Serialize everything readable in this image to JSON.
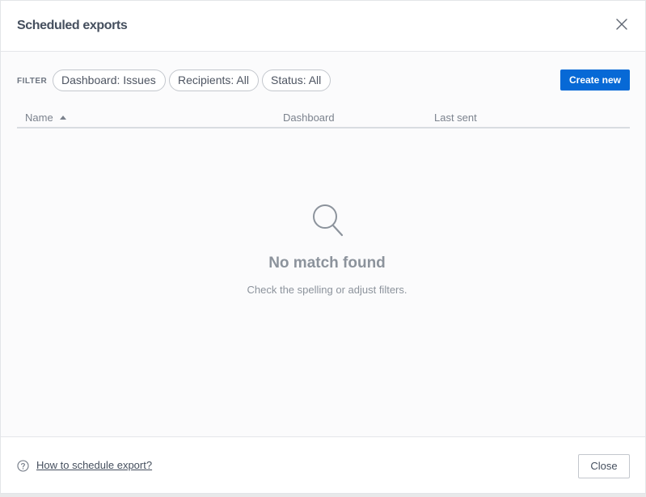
{
  "dialog": {
    "title": "Scheduled exports",
    "close_icon": "close-icon"
  },
  "filter": {
    "label": "FILTER",
    "chips": [
      {
        "label": "Dashboard: Issues"
      },
      {
        "label": "Recipients: All"
      },
      {
        "label": "Status: All"
      }
    ]
  },
  "actions": {
    "create_label": "Create new",
    "accent_color": "#0769d6"
  },
  "table": {
    "columns": [
      "Name",
      "Dashboard",
      "Last sent"
    ],
    "sort": {
      "column": "Name",
      "direction": "ascending",
      "icon": "sort-ascending-icon"
    }
  },
  "empty_state": {
    "icon": "search-icon",
    "title": "No match found",
    "subtitle": "Check the spelling or adjust filters."
  },
  "footer": {
    "help_icon": "question-circle-icon",
    "help_link": "How to schedule export?",
    "close_label": "Close"
  }
}
